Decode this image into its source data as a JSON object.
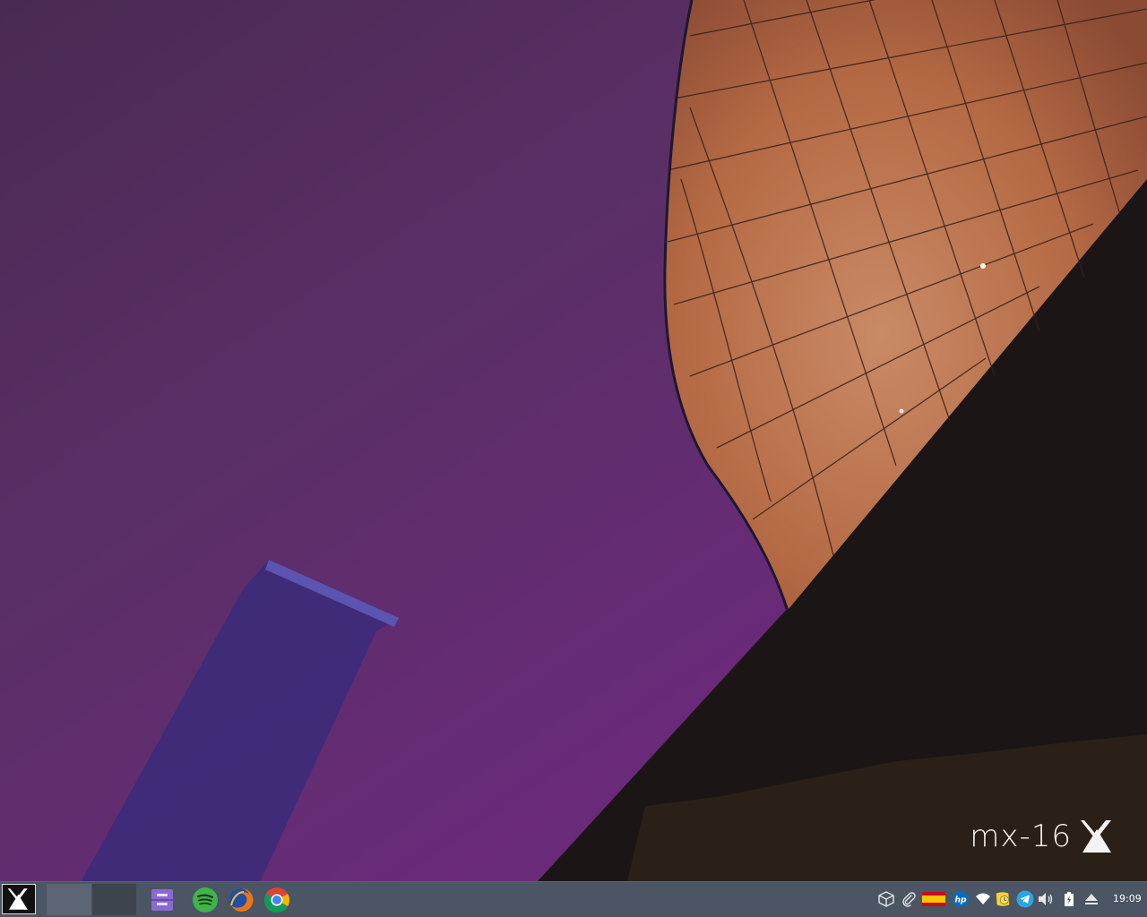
{
  "desktop": {
    "watermark_text": "mx-16"
  },
  "panel": {
    "menu_icon": "mx-logo-icon",
    "workspaces": [
      "workspace-1",
      "workspace-2"
    ],
    "launchers": [
      "file-manager-icon",
      "spotify-icon",
      "firefox-icon",
      "chrome-icon"
    ],
    "tray_icons": [
      "package-box-icon",
      "paperclip-icon",
      "spain-flag-icon",
      "hp-printer-icon",
      "wifi-icon",
      "clipboard-note-icon",
      "telegram-icon",
      "volume-icon",
      "battery-icon",
      "eject-icon"
    ],
    "clock": "19:09"
  },
  "colors": {
    "panel_bg": "#4b5563",
    "workspace_active": "#5b6573",
    "workspace_inactive": "#3d444d"
  }
}
